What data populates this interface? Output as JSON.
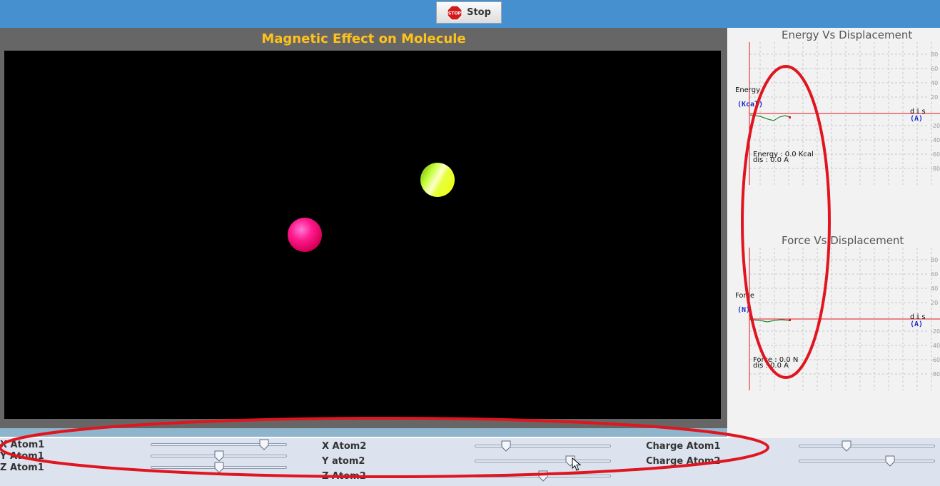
{
  "toolbar": {
    "stop_label": "Stop",
    "stop_icon": "stop-sign-icon",
    "stop_sign_text": "STOP"
  },
  "simulation": {
    "title": "Magnetic Effect on Molecule",
    "atom1_color": "#ff1a8c",
    "atom2_color": "#d4ff20"
  },
  "controls": {
    "labels": {
      "x_atom1": "X Atom1",
      "y_atom1": "Y Atom1",
      "z_atom1": "Z Atom1",
      "x_atom2": "X Atom2",
      "y_atom2": "Y atom2",
      "z_atom2": "Z Atom2",
      "charge_atom1": "Charge Atom1",
      "charge_atom2": "Charge Atom2"
    },
    "values": {
      "x_atom1": 0.83,
      "y_atom1": 0.5,
      "z_atom1": 0.5,
      "x_atom2": 0.23,
      "y_atom2": 0.7,
      "z_atom2": 0.5,
      "charge_atom1": 0.35,
      "charge_atom2": 0.67
    }
  },
  "energy_graph": {
    "title": "Energy Vs Displacement",
    "y_label": "Energy",
    "y_unit": "(Kcal)",
    "x_label": "dis",
    "x_unit": "(A)",
    "ticks": [
      "80",
      "60",
      "40",
      "20",
      "-20",
      "-40",
      "-60",
      "-80"
    ],
    "readout_value": "Energy : 0.0 Kcal",
    "readout_dis": "dis : 0.0 A"
  },
  "force_graph": {
    "title": "Force Vs Displacement",
    "y_label": "Force",
    "y_unit": "(N)",
    "x_label": "dis",
    "x_unit": "(A)",
    "ticks": [
      "80",
      "60",
      "40",
      "20",
      "-20",
      "-40",
      "-60",
      "-80"
    ],
    "readout_value": "Force : 0.0 N",
    "readout_dis": "dis : 0.0 A"
  },
  "annotation_color": "#e0151f"
}
